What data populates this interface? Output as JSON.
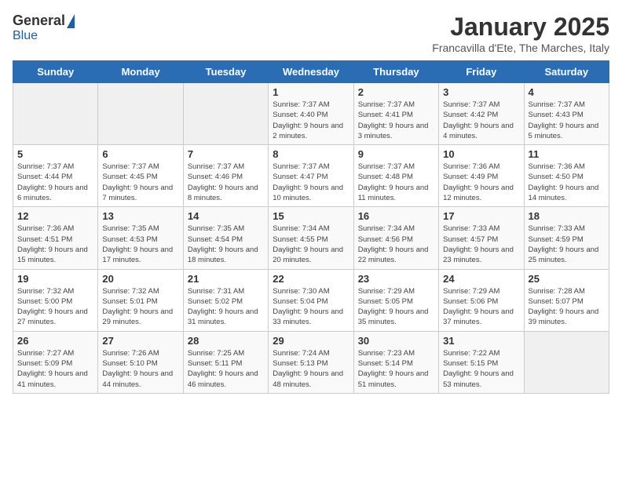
{
  "logo": {
    "general": "General",
    "blue": "Blue"
  },
  "header": {
    "month": "January 2025",
    "location": "Francavilla d'Ete, The Marches, Italy"
  },
  "weekdays": [
    "Sunday",
    "Monday",
    "Tuesday",
    "Wednesday",
    "Thursday",
    "Friday",
    "Saturday"
  ],
  "weeks": [
    [
      {
        "day": "",
        "info": ""
      },
      {
        "day": "",
        "info": ""
      },
      {
        "day": "",
        "info": ""
      },
      {
        "day": "1",
        "info": "Sunrise: 7:37 AM\nSunset: 4:40 PM\nDaylight: 9 hours and 2 minutes."
      },
      {
        "day": "2",
        "info": "Sunrise: 7:37 AM\nSunset: 4:41 PM\nDaylight: 9 hours and 3 minutes."
      },
      {
        "day": "3",
        "info": "Sunrise: 7:37 AM\nSunset: 4:42 PM\nDaylight: 9 hours and 4 minutes."
      },
      {
        "day": "4",
        "info": "Sunrise: 7:37 AM\nSunset: 4:43 PM\nDaylight: 9 hours and 5 minutes."
      }
    ],
    [
      {
        "day": "5",
        "info": "Sunrise: 7:37 AM\nSunset: 4:44 PM\nDaylight: 9 hours and 6 minutes."
      },
      {
        "day": "6",
        "info": "Sunrise: 7:37 AM\nSunset: 4:45 PM\nDaylight: 9 hours and 7 minutes."
      },
      {
        "day": "7",
        "info": "Sunrise: 7:37 AM\nSunset: 4:46 PM\nDaylight: 9 hours and 8 minutes."
      },
      {
        "day": "8",
        "info": "Sunrise: 7:37 AM\nSunset: 4:47 PM\nDaylight: 9 hours and 10 minutes."
      },
      {
        "day": "9",
        "info": "Sunrise: 7:37 AM\nSunset: 4:48 PM\nDaylight: 9 hours and 11 minutes."
      },
      {
        "day": "10",
        "info": "Sunrise: 7:36 AM\nSunset: 4:49 PM\nDaylight: 9 hours and 12 minutes."
      },
      {
        "day": "11",
        "info": "Sunrise: 7:36 AM\nSunset: 4:50 PM\nDaylight: 9 hours and 14 minutes."
      }
    ],
    [
      {
        "day": "12",
        "info": "Sunrise: 7:36 AM\nSunset: 4:51 PM\nDaylight: 9 hours and 15 minutes."
      },
      {
        "day": "13",
        "info": "Sunrise: 7:35 AM\nSunset: 4:53 PM\nDaylight: 9 hours and 17 minutes."
      },
      {
        "day": "14",
        "info": "Sunrise: 7:35 AM\nSunset: 4:54 PM\nDaylight: 9 hours and 18 minutes."
      },
      {
        "day": "15",
        "info": "Sunrise: 7:34 AM\nSunset: 4:55 PM\nDaylight: 9 hours and 20 minutes."
      },
      {
        "day": "16",
        "info": "Sunrise: 7:34 AM\nSunset: 4:56 PM\nDaylight: 9 hours and 22 minutes."
      },
      {
        "day": "17",
        "info": "Sunrise: 7:33 AM\nSunset: 4:57 PM\nDaylight: 9 hours and 23 minutes."
      },
      {
        "day": "18",
        "info": "Sunrise: 7:33 AM\nSunset: 4:59 PM\nDaylight: 9 hours and 25 minutes."
      }
    ],
    [
      {
        "day": "19",
        "info": "Sunrise: 7:32 AM\nSunset: 5:00 PM\nDaylight: 9 hours and 27 minutes."
      },
      {
        "day": "20",
        "info": "Sunrise: 7:32 AM\nSunset: 5:01 PM\nDaylight: 9 hours and 29 minutes."
      },
      {
        "day": "21",
        "info": "Sunrise: 7:31 AM\nSunset: 5:02 PM\nDaylight: 9 hours and 31 minutes."
      },
      {
        "day": "22",
        "info": "Sunrise: 7:30 AM\nSunset: 5:04 PM\nDaylight: 9 hours and 33 minutes."
      },
      {
        "day": "23",
        "info": "Sunrise: 7:29 AM\nSunset: 5:05 PM\nDaylight: 9 hours and 35 minutes."
      },
      {
        "day": "24",
        "info": "Sunrise: 7:29 AM\nSunset: 5:06 PM\nDaylight: 9 hours and 37 minutes."
      },
      {
        "day": "25",
        "info": "Sunrise: 7:28 AM\nSunset: 5:07 PM\nDaylight: 9 hours and 39 minutes."
      }
    ],
    [
      {
        "day": "26",
        "info": "Sunrise: 7:27 AM\nSunset: 5:09 PM\nDaylight: 9 hours and 41 minutes."
      },
      {
        "day": "27",
        "info": "Sunrise: 7:26 AM\nSunset: 5:10 PM\nDaylight: 9 hours and 44 minutes."
      },
      {
        "day": "28",
        "info": "Sunrise: 7:25 AM\nSunset: 5:11 PM\nDaylight: 9 hours and 46 minutes."
      },
      {
        "day": "29",
        "info": "Sunrise: 7:24 AM\nSunset: 5:13 PM\nDaylight: 9 hours and 48 minutes."
      },
      {
        "day": "30",
        "info": "Sunrise: 7:23 AM\nSunset: 5:14 PM\nDaylight: 9 hours and 51 minutes."
      },
      {
        "day": "31",
        "info": "Sunrise: 7:22 AM\nSunset: 5:15 PM\nDaylight: 9 hours and 53 minutes."
      },
      {
        "day": "",
        "info": ""
      }
    ]
  ]
}
